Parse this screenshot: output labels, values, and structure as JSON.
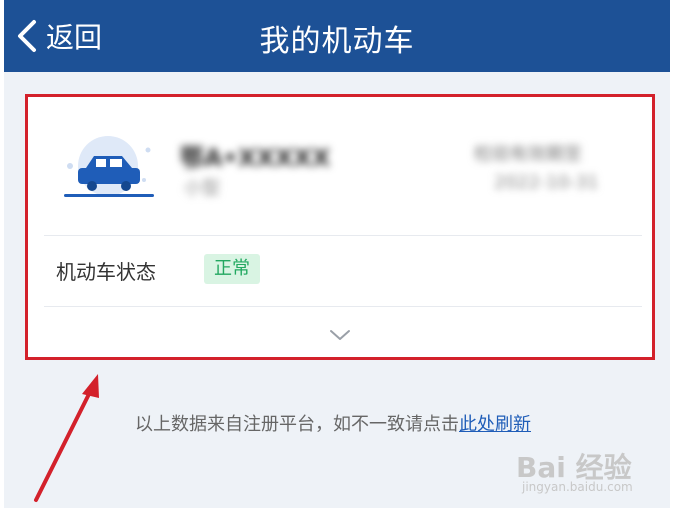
{
  "header": {
    "back_label": "返回",
    "title": "我的机动车",
    "bg_color": "#1d5196"
  },
  "vehicle_card": {
    "plate_blurred": "鄂A•XXXXX",
    "sub_blurred": "小型",
    "right_line1_blurred": "检验有效期至",
    "right_line2_blurred": "2022-10-31",
    "status_label": "机动车状态",
    "status_badge": "正常",
    "status_color": "#22a860"
  },
  "note": {
    "text": "以上数据来自注册平台，如不一致请点击",
    "link": "此处刷新"
  },
  "watermark": {
    "main": "Bai 经验",
    "sub": "jingyan.baidu.com"
  },
  "annotation_color": "#d3212b"
}
